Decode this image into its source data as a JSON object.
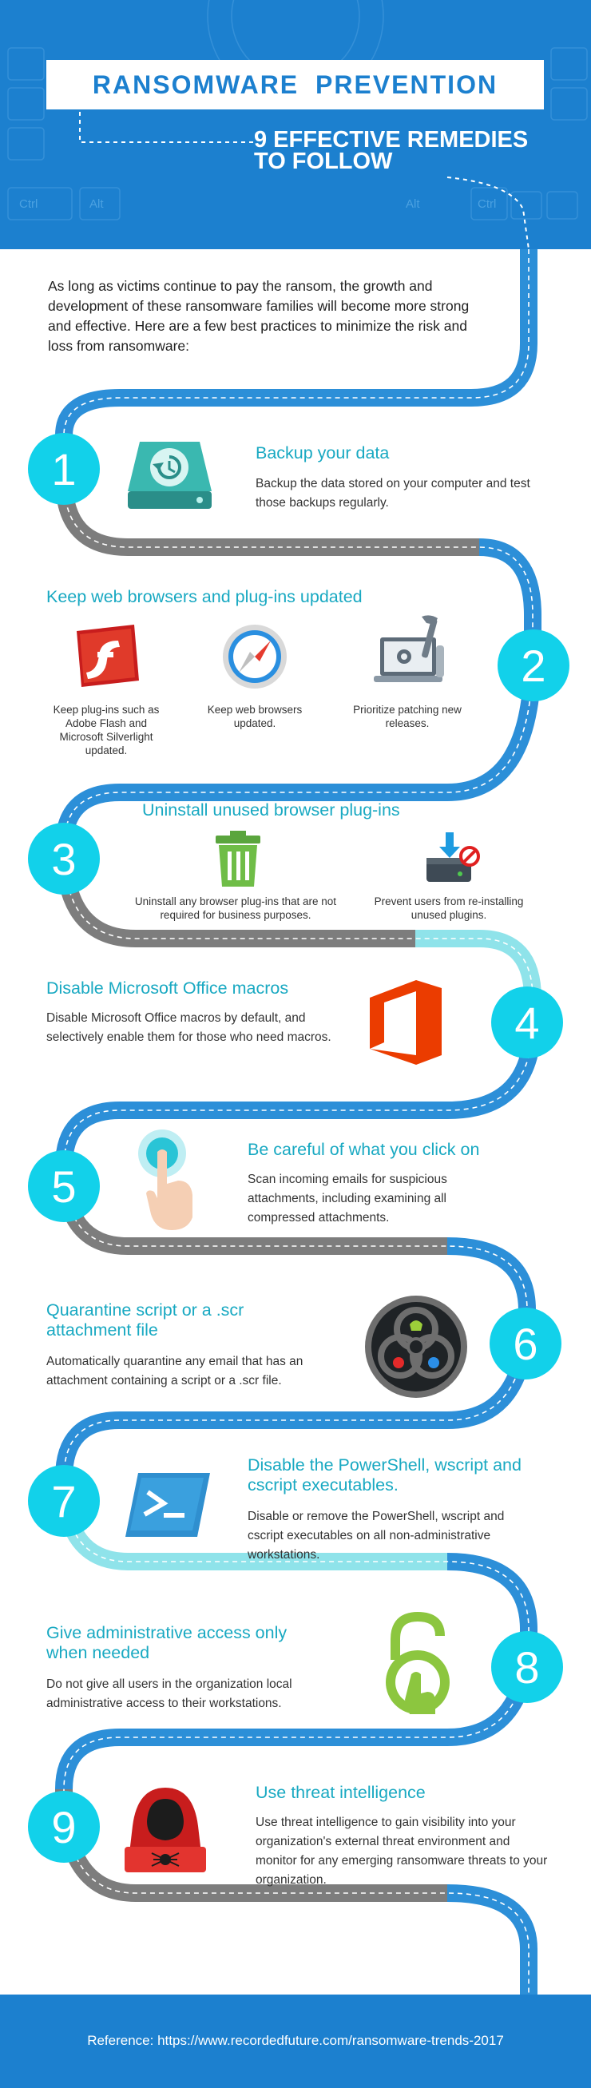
{
  "header": {
    "title": "RANSOMWARE  PREVENTION",
    "subtitle_line1": "9 EFFECTIVE REMEDIES",
    "subtitle_line2": "TO FOLLOW",
    "keys": [
      "Ctrl",
      "Alt",
      "Alt",
      "Ctrl"
    ]
  },
  "intro": "As long as victims continue to pay the ransom, the growth and development of these ransomware families will become more strong and effective. Here are a few best practices to minimize the risk and loss from ransomware:",
  "steps": [
    {
      "number": "1",
      "title": "Backup your data",
      "text": "Backup the data stored on your computer and test those backups regularly.",
      "icon": "backup-drive-icon"
    },
    {
      "number": "2",
      "title": "Keep web browsers and plug-ins updated",
      "items": [
        {
          "caption": "Keep plug-ins such as Adobe Flash and Microsoft Silverlight updated.",
          "icon": "adobe-flash-icon"
        },
        {
          "caption": "Keep web browsers updated.",
          "icon": "safari-compass-icon"
        },
        {
          "caption": "Prioritize patching new releases.",
          "icon": "laptop-tools-icon"
        }
      ]
    },
    {
      "number": "3",
      "title": "Uninstall unused browser plug-ins",
      "items": [
        {
          "caption": "Uninstall any browser plug-ins that are not required for business purposes.",
          "icon": "trash-can-icon"
        },
        {
          "caption": "Prevent users from re-installing unused plugins.",
          "icon": "blocked-install-icon"
        }
      ]
    },
    {
      "number": "4",
      "title": "Disable Microsoft Office macros",
      "text": "Disable Microsoft Office macros by default, and selectively enable them for those who need macros.",
      "icon": "microsoft-office-icon"
    },
    {
      "number": "5",
      "title": "Be careful of what you click on",
      "text": "Scan incoming emails for suspicious attachments, including examining all compressed attachments.",
      "icon": "finger-tap-icon"
    },
    {
      "number": "6",
      "title": "Quarantine script or a .scr attachment file",
      "text": "Automatically quarantine any email that has an attachment containing a script or a .scr file.",
      "icon": "biohazard-icon"
    },
    {
      "number": "7",
      "title": "Disable the PowerShell, wscript and cscript executables.",
      "text": "Disable or remove the PowerShell, wscript and cscript executables on all non-administrative workstations.",
      "icon": "powershell-icon"
    },
    {
      "number": "8",
      "title": "Give administrative access only when needed",
      "text": "Do not give all users in the organization local administrative access to their workstations.",
      "icon": "unlocked-padlock-icon"
    },
    {
      "number": "9",
      "title": "Use threat intelligence",
      "text": "Use threat intelligence to gain visibility into your organization's external threat environment and monitor for any emerging ransomware threats to your organization.",
      "icon": "hooded-hacker-icon"
    }
  ],
  "footer": {
    "reference": "Reference: https://www.recordedfuture.com/ransomware-trends-2017"
  },
  "colors": {
    "brand_blue": "#1c80cf",
    "road_blue": "#2c8fd8",
    "road_gray": "#7d7d7d",
    "road_teal": "#8fe3ea",
    "badge": "#12d1ea",
    "heading": "#19a9c2"
  }
}
